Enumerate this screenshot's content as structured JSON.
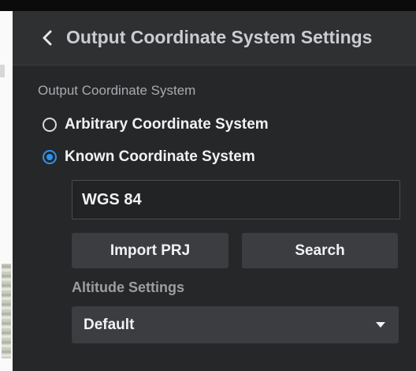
{
  "header": {
    "title": "Output Coordinate System Settings",
    "back_icon": "chevron-left-icon"
  },
  "output_coordinate_system": {
    "section_label": "Output Coordinate System",
    "options": [
      {
        "label": "Arbitrary Coordinate System",
        "selected": false
      },
      {
        "label": "Known Coordinate System",
        "selected": true
      }
    ],
    "coordinate_system_value": "WGS 84",
    "import_prj_label": "Import PRJ",
    "search_label": "Search"
  },
  "altitude": {
    "label": "Altitude Settings",
    "selected_value": "Default",
    "dropdown_icon": "caret-down-icon"
  },
  "colors": {
    "accent": "#2e92ee",
    "panel_background": "#262729",
    "button_background": "#3c3d40"
  }
}
